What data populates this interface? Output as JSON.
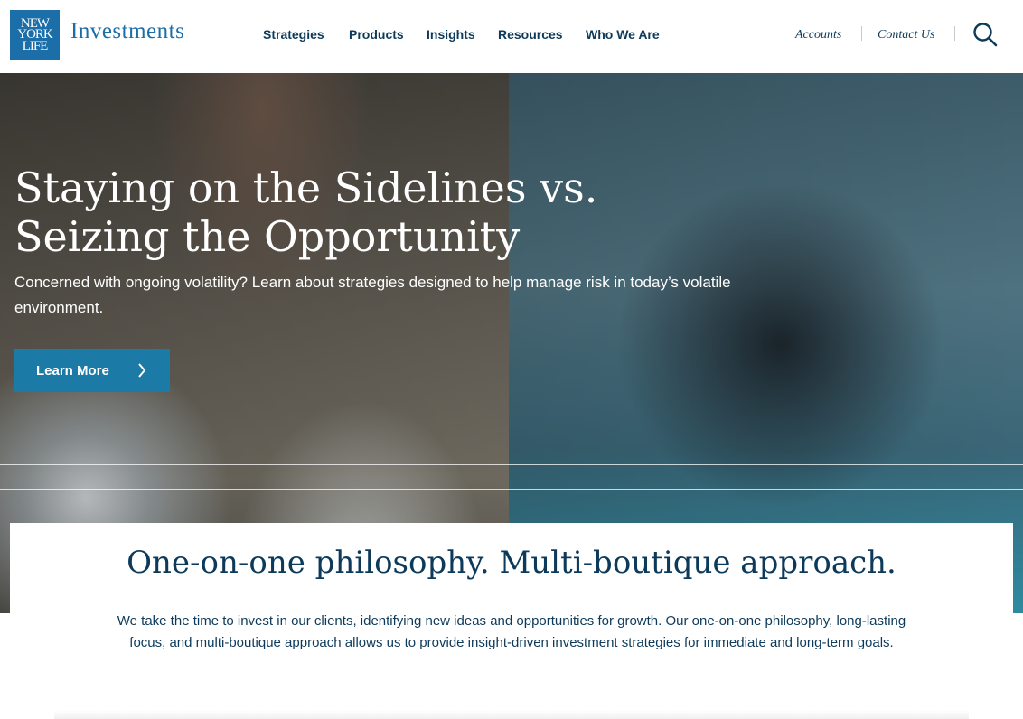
{
  "brand": {
    "logo_lines": [
      "NEW",
      "YORK",
      "LIFE"
    ],
    "name": "Investments"
  },
  "nav": {
    "items": [
      "Strategies",
      "Products",
      "Insights",
      "Resources",
      "Who We Are"
    ]
  },
  "utility": {
    "accounts": "Accounts",
    "contact": "Contact Us"
  },
  "hero": {
    "title_line1": "Staying on the Sidelines vs.",
    "title_line2": "Seizing the Opportunity",
    "subtitle": "Concerned with ongoing volatility? Learn about strategies designed to help manage risk in today’s volatile environment.",
    "cta_label": "Learn More"
  },
  "intro": {
    "title": "One-on-one philosophy. Multi-boutique approach.",
    "text": "We take the time to invest in our clients, identifying new ideas and opportunities for growth. Our one-on-one philosophy, long-lasting focus, and multi-boutique approach allows us to provide insight-driven investment strategies for immediate and long-term goals."
  },
  "colors": {
    "brand_blue": "#1b6ea8",
    "navy_text": "#0d3a5a",
    "cta_blue": "#1b7aa6"
  },
  "icons": [
    "search-icon",
    "chevron-right-icon"
  ]
}
